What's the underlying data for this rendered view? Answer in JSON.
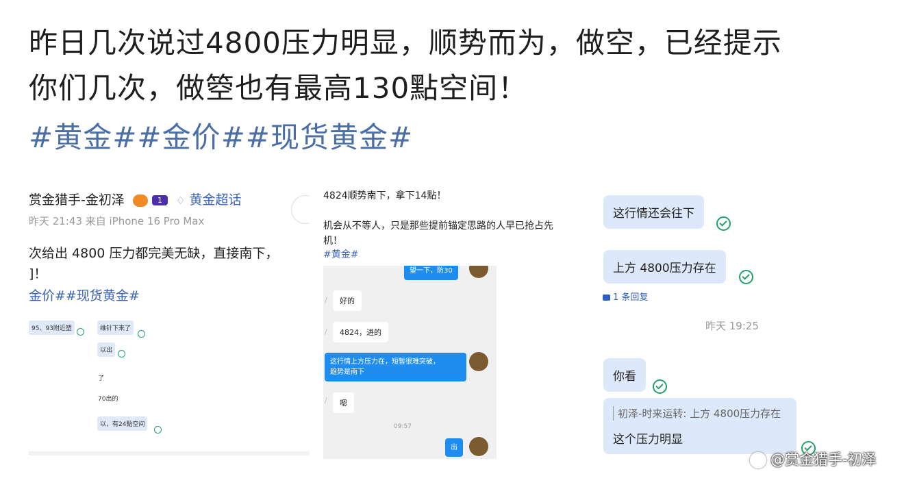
{
  "post": {
    "line1": "昨日几次说过4800压力明显，顺势而为，做空，已经提示",
    "line2": "你们几次，做箜也有最高130點空间！",
    "hashtags": "#黄金##金价##现货黄金#"
  },
  "panel1": {
    "author": "赏金猎手-金初泽",
    "level": "1",
    "topic": "黄金超话",
    "meta": "昨天 21:43  来自 iPhone 16 Pro Max",
    "body_line1": "次给出 4800 压力都完美无缺，直接南下，",
    "body_line2": "]！",
    "tags": "金价##现货黄金#",
    "mini": [
      "95、93附近塑",
      "维针下来了",
      "以出",
      "了",
      "70出的",
      "以，有24點空间"
    ]
  },
  "panel2": {
    "line1": "4824顺势南下，拿下14點！",
    "line2": "机会从不等人，只是那些提前锚定思路的人早已抢占先",
    "line3": "机！",
    "tag": "#黄金#",
    "chat": {
      "top_out": "望一下，防30",
      "in1": "好的",
      "in2": "4824，进的",
      "out1_line1": "这行情上方压力在，短暂很难突破，",
      "out1_line2": "趋势是南下",
      "in3": "嗯",
      "time": "09:57",
      "out2": "出"
    }
  },
  "panel3": {
    "msg1": "这行情还会往下",
    "msg2": "上方 4800压力存在",
    "reply_link": "1 条回复",
    "time": "昨天 19:25",
    "msg3": "你看",
    "quote": "初泽-时来运转: 上方 4800压力存在",
    "msg4": "这个压力明显"
  },
  "watermark": "@赏金猎手-初泽",
  "colors": {
    "link": "#4a6ea5",
    "bubble": "#dde9fb",
    "check": "#22a06b",
    "outgoing": "#1f8cf0"
  }
}
